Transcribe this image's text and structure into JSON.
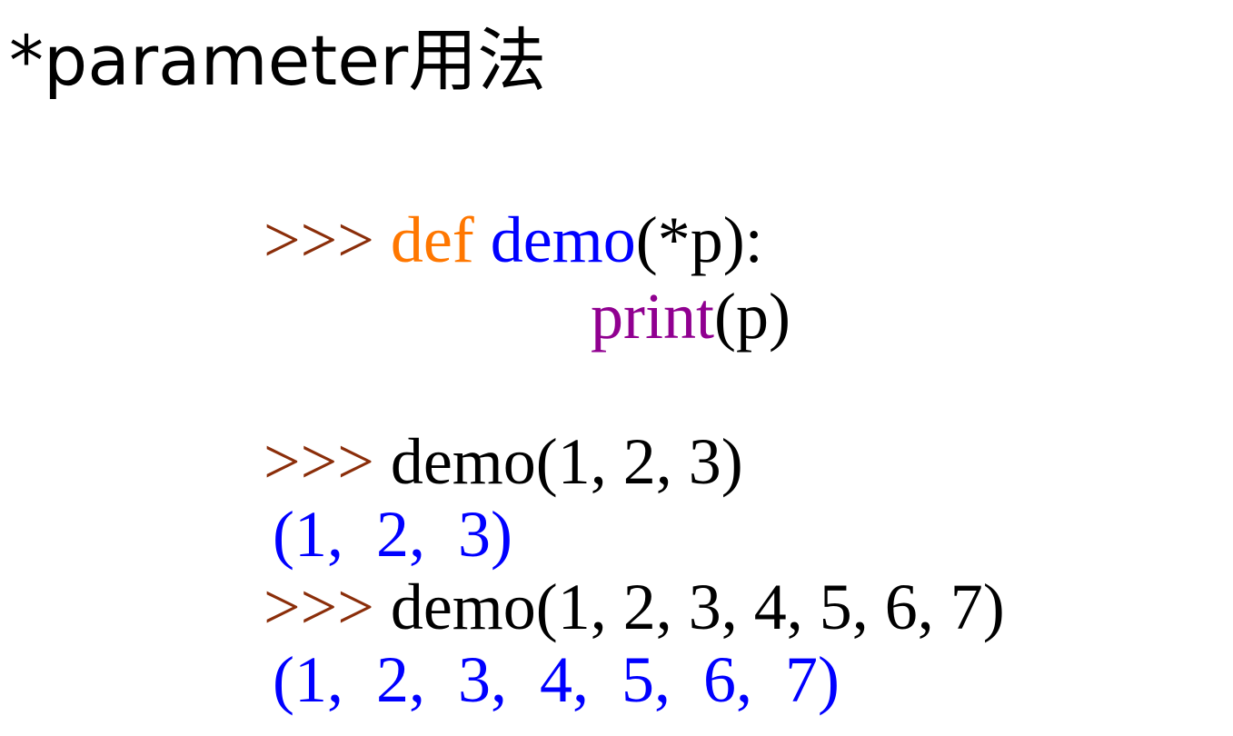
{
  "title": "*parameter用法",
  "code": {
    "def_line": {
      "prompt": ">>>",
      "keyword": "def",
      "function_name": "demo",
      "signature": "(*p):"
    },
    "body_line": {
      "builtin": "print",
      "args": "(p)"
    },
    "call_1": {
      "prompt": ">>>",
      "code": "demo(1, 2, 3)"
    },
    "output_1": "(1,  2,  3)",
    "call_2": {
      "prompt": ">>>",
      "code": "demo(1, 2, 3, 4, 5, 6, 7)"
    },
    "output_2": "(1,  2,  3,  4,  5,  6,  7)"
  },
  "colors": {
    "prompt": "#8b2e0a",
    "keyword": "#ff7700",
    "function_name": "#0000ff",
    "builtin": "#900090",
    "output": "#0000ff",
    "text": "#000000"
  }
}
